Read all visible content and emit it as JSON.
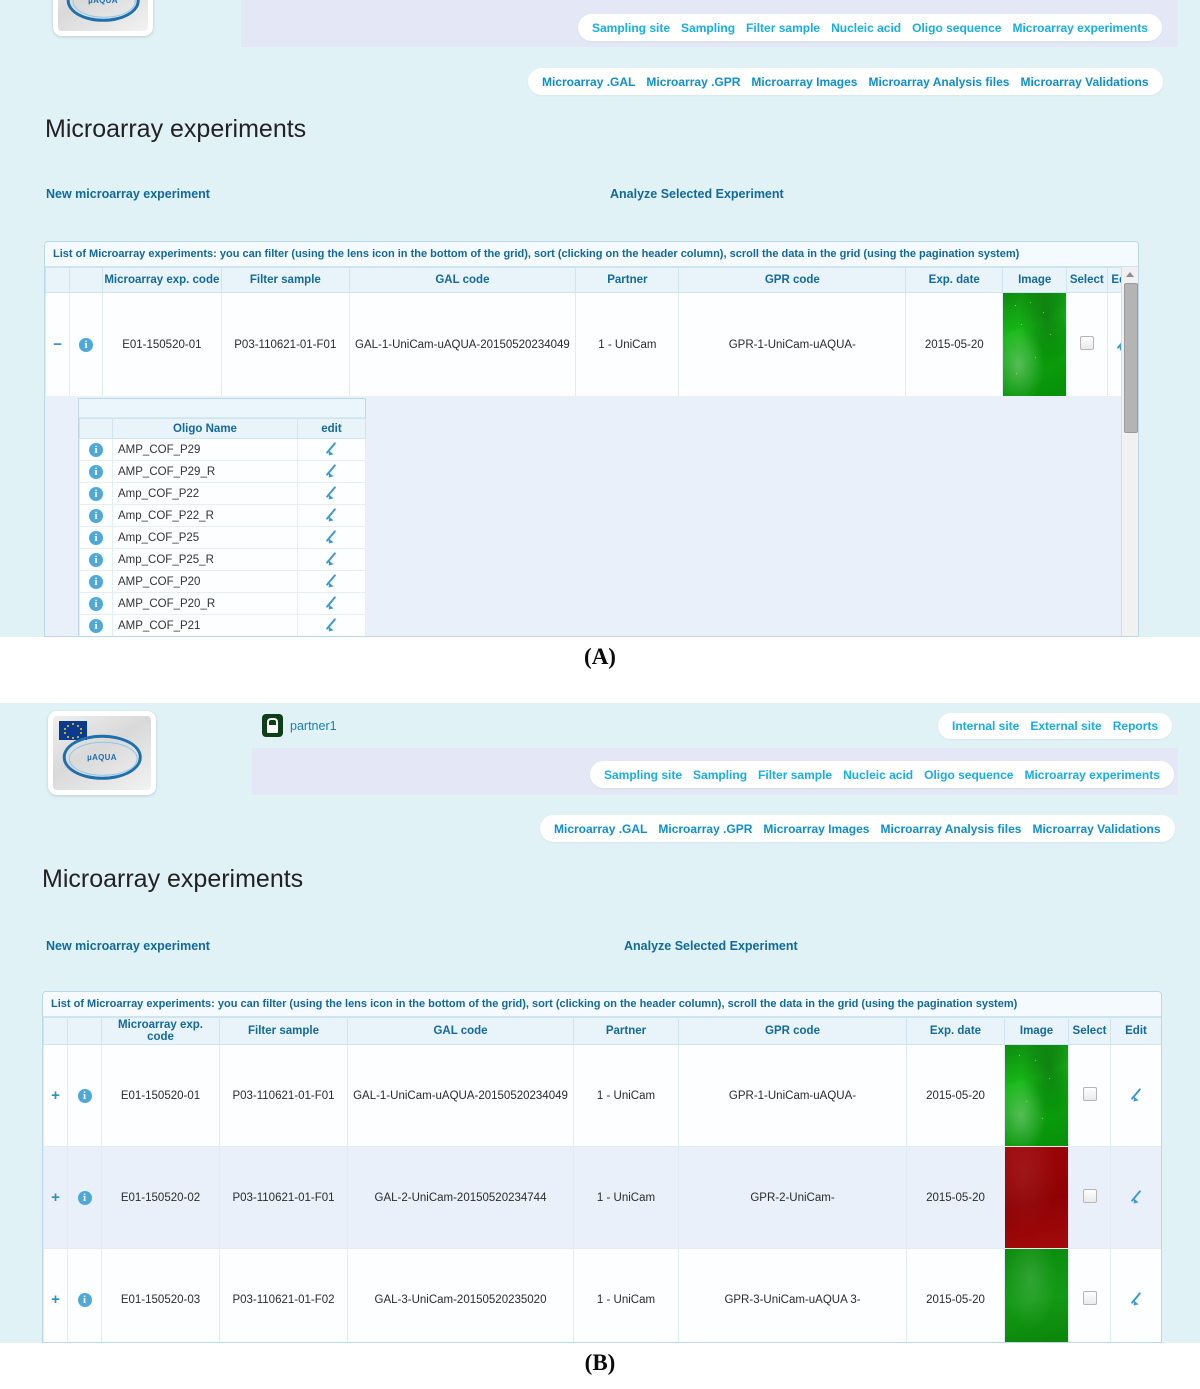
{
  "figure": {
    "caption_a": "(A)",
    "caption_b": "(B)"
  },
  "branding": {
    "logo_text": "µAQUA",
    "logo_name": "uaqua-logo",
    "eu_flag_name": "eu-flag"
  },
  "account": {
    "lock_icon": "lock-icon",
    "user": "partner1"
  },
  "site_nav": {
    "items": [
      {
        "label": "Internal site"
      },
      {
        "label": "External site"
      },
      {
        "label": "Reports"
      }
    ]
  },
  "main_nav": {
    "items": [
      {
        "label": "Sampling site"
      },
      {
        "label": "Sampling"
      },
      {
        "label": "Filter sample"
      },
      {
        "label": "Nucleic acid"
      },
      {
        "label": "Oligo sequence"
      },
      {
        "label": "Microarray experiments"
      }
    ]
  },
  "sub_nav": {
    "items": [
      {
        "label": "Microarray .GAL"
      },
      {
        "label": "Microarray .GPR"
      },
      {
        "label": "Microarray Images"
      },
      {
        "label": "Microarray Analysis files"
      },
      {
        "label": "Microarray Validations"
      }
    ]
  },
  "page": {
    "title": "Microarray experiments",
    "new_link": "New microarray experiment",
    "analyze_link": "Analyze Selected Experiment"
  },
  "grid": {
    "caption": "List of Microarray experiments: you can filter (using the lens icon in the bottom of the grid), sort (clicking on the header column), scroll the data in the grid (using the pagination system)",
    "headers": [
      "",
      "",
      "Microarray exp. code",
      "Filter sample",
      "GAL code",
      "Partner",
      "GPR code",
      "Exp. date",
      "Image",
      "Select",
      "Edit"
    ],
    "rows_a": [
      {
        "expander": "−",
        "info_icon": "info-icon",
        "exp_code": "E01-150520-01",
        "filter_sample": "P03-110621-01-F01",
        "gal_code": "GAL-1-UniCam-uAQUA-20150520234049",
        "partner": "1 - UniCam",
        "gpr_code": "GPR-1-UniCam-uAQUA-",
        "exp_date": "2015-05-20",
        "image_kind": "green",
        "selected": false
      }
    ],
    "rows_b": [
      {
        "expander": "+",
        "info_icon": "info-icon",
        "exp_code": "E01-150520-01",
        "filter_sample": "P03-110621-01-F01",
        "gal_code": "GAL-1-UniCam-uAQUA-20150520234049",
        "partner": "1 - UniCam",
        "gpr_code": "GPR-1-UniCam-uAQUA-",
        "exp_date": "2015-05-20",
        "image_kind": "green",
        "selected": false
      },
      {
        "expander": "+",
        "info_icon": "info-icon",
        "exp_code": "E01-150520-02",
        "filter_sample": "P03-110621-01-F01",
        "gal_code": "GAL-2-UniCam-20150520234744",
        "partner": "1 - UniCam",
        "gpr_code": "GPR-2-UniCam-",
        "exp_date": "2015-05-20",
        "image_kind": "red",
        "selected": false
      },
      {
        "expander": "+",
        "info_icon": "info-icon",
        "exp_code": "E01-150520-03",
        "filter_sample": "P03-110621-01-F02",
        "gal_code": "GAL-3-UniCam-20150520235020",
        "partner": "1 - UniCam",
        "gpr_code": "GPR-3-UniCam-uAQUA 3-",
        "exp_date": "2015-05-20",
        "image_kind": "green2",
        "selected": false
      }
    ]
  },
  "oligo_grid": {
    "headers": [
      "",
      "Oligo Name",
      "edit"
    ],
    "rows": [
      {
        "name": "AMP_COF_P29"
      },
      {
        "name": "AMP_COF_P29_R"
      },
      {
        "name": "Amp_COF_P22"
      },
      {
        "name": "Amp_COF_P22_R"
      },
      {
        "name": "Amp_COF_P25"
      },
      {
        "name": "Amp_COF_P25_R"
      },
      {
        "name": "AMP_COF_P20"
      },
      {
        "name": "AMP_COF_P20_R"
      },
      {
        "name": "AMP_COF_P21"
      }
    ]
  },
  "colors": {
    "page_bg": "#e1f2f6",
    "nav_band": "#e4e8f6",
    "link_blue": "#17aee6",
    "action_blue": "#12699c",
    "header_blue": "#14699d",
    "image_green": "#12a313",
    "image_red": "#980607",
    "lock_green": "#0d4019"
  }
}
